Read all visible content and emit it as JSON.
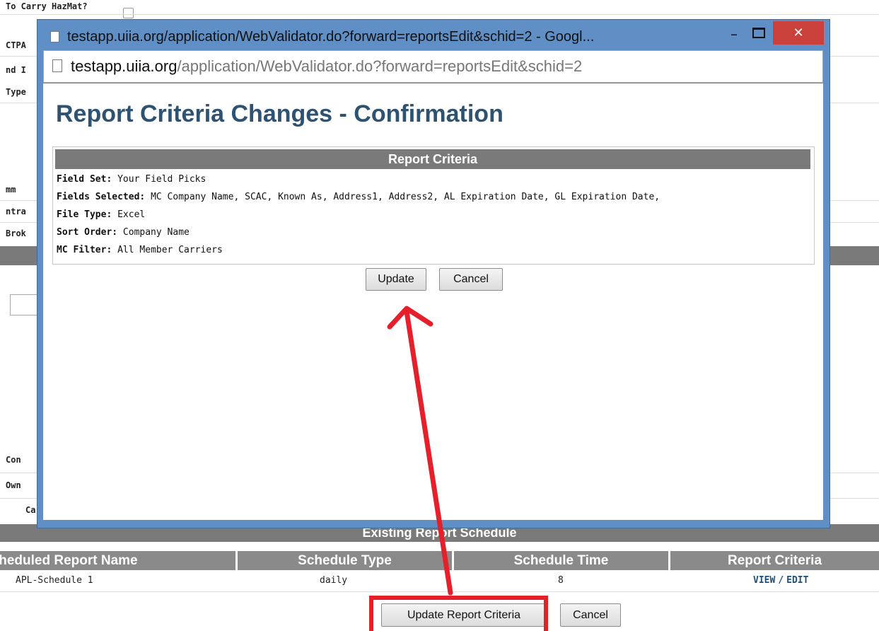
{
  "background": {
    "left_labels": [
      "To Carry HazMat?",
      "CTPA",
      "nd I",
      "Type",
      "mm",
      "ntra",
      "Brok",
      "Con",
      "Own",
      "Ca"
    ],
    "schedule_section_title": "Existing Report Schedule",
    "schedule_columns": [
      "Scheduled Report Name",
      "Schedule Type",
      "Schedule Time",
      "Report Criteria"
    ],
    "schedule_rows": [
      {
        "name": "APL-Schedule 1",
        "type": "daily",
        "time": "8",
        "view_link": "VIEW",
        "separator": "/",
        "edit_link": "EDIT"
      }
    ],
    "update_button_label": "Update Report Criteria",
    "cancel_button_label": "Cancel"
  },
  "popup": {
    "window_title": "testapp.uiia.org/application/WebValidator.do?forward=reportsEdit&schid=2 - Googl...",
    "address_host": "testapp.uiia.org",
    "address_path": "/application/WebValidator.do?forward=reportsEdit&schid=2",
    "close_glyph": "✕",
    "minimize_glyph": "–",
    "page_title": "Report Criteria Changes - Confirmation",
    "criteria_header": "Report Criteria",
    "criteria": [
      {
        "label": "Field Set:",
        "value": "Your Field Picks"
      },
      {
        "label": "Fields Selected:",
        "value": "MC Company Name, SCAC, Known As, Address1, Address2, AL Expiration Date, GL Expiration Date,"
      },
      {
        "label": "File Type:",
        "value": "Excel"
      },
      {
        "label": "Sort Order:",
        "value": "Company Name"
      },
      {
        "label": "MC Filter:",
        "value": "All Member Carriers"
      }
    ],
    "update_button_label": "Update",
    "cancel_button_label": "Cancel"
  },
  "colors": {
    "annotation_red": "#e5202a",
    "title_blue": "#2e5372",
    "header_gray": "#7a7a7a",
    "window_frame": "#5f8fc4"
  },
  "icons": [
    "page-icon",
    "minimize-icon",
    "maximize-icon",
    "close-icon",
    "annotation-arrow"
  ]
}
